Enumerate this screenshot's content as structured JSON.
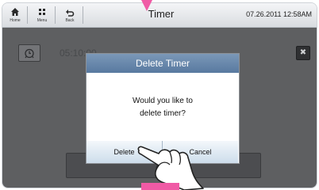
{
  "header": {
    "home_label": "Home",
    "menu_label": "Menu",
    "back_label": "Back",
    "title": "Timer",
    "datetime": "07.26.2011 12:58AM"
  },
  "background": {
    "timer_time": "05:10:00",
    "add_label": "Add"
  },
  "dialog": {
    "title": "Delete Timer",
    "message_line1": "Would you like to",
    "message_line2": "delete timer?",
    "delete_label": "Delete",
    "cancel_label": "Cancel"
  },
  "icons": {
    "home": "home-icon",
    "menu": "menu-grid-icon",
    "back": "back-arrow-icon",
    "timer": "alarm-clock-icon",
    "close": "close-icon",
    "pointer": "hand-pointer-icon"
  },
  "colors": {
    "dialog_header": "#6686aa",
    "overlay": "#5e5f61",
    "highlight": "#f05aa5"
  }
}
